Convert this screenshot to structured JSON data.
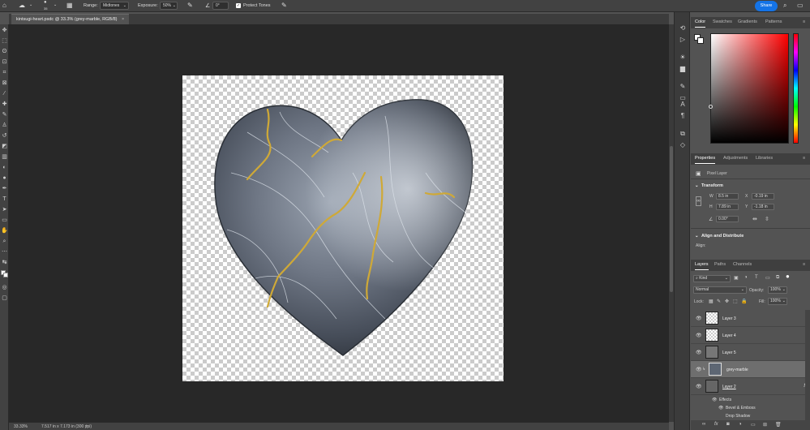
{
  "options_bar": {
    "brush_size": "35",
    "range_label": "Range:",
    "range_value": "Midtones",
    "exposure_label": "Exposure:",
    "exposure_value": "50%",
    "angle_value": "0°",
    "protect_tones_label": "Protect Tones",
    "protect_tones_checked": true,
    "share_label": "Share",
    "accent_color": "#1473e6"
  },
  "document": {
    "tab_title": "kintsugi-heart.psdc @ 33.3% (grey-marble, RGB/8)"
  },
  "status_bar": {
    "zoom": "33.33%",
    "doc_size": "7.517 in x 7.173 in (300 ppi)"
  },
  "color_panel": {
    "tabs": [
      "Color",
      "Swatches",
      "Gradients",
      "Patterns"
    ],
    "active_tab": "Color"
  },
  "properties_panel": {
    "tabs": [
      "Properties",
      "Adjustments",
      "Libraries"
    ],
    "active_tab": "Properties",
    "layer_type": "Pixel Layer",
    "transform_header": "Transform",
    "w_label": "W",
    "w_value": "8.5 in",
    "h_label": "H",
    "h_value": "7.89 in",
    "x_label": "X",
    "x_value": "-0.19 in",
    "y_label": "Y",
    "y_value": "-1.18 in",
    "angle_value": "0.00°",
    "align_header": "Align and Distribute",
    "align_label": "Align:"
  },
  "layers_panel": {
    "tabs": [
      "Layers",
      "Paths",
      "Channels"
    ],
    "active_tab": "Layers",
    "filter_kind": "Kind",
    "blend_mode": "Normal",
    "opacity_label": "Opacity:",
    "opacity_value": "100%",
    "lock_label": "Lock:",
    "fill_label": "Fill:",
    "fill_value": "100%",
    "layers": [
      {
        "name": "Layer 3",
        "selected": false,
        "visible": true
      },
      {
        "name": "Layer 4",
        "selected": false,
        "visible": true
      },
      {
        "name": "Layer 5",
        "selected": false,
        "visible": true
      },
      {
        "name": "grey-marble",
        "selected": true,
        "visible": true
      },
      {
        "name": "Layer 2",
        "selected": false,
        "visible": true,
        "fx": "fx"
      }
    ],
    "effects_label": "Effects",
    "effects": [
      "Bevel & Emboss",
      "Drop Shadow"
    ]
  }
}
